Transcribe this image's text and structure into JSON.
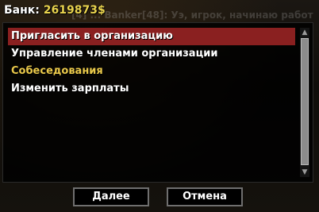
{
  "bank": {
    "label": "Банк:",
    "amount": "2619873$",
    "amount_color": "#e9d34e"
  },
  "background_text": "[4] ... Banker[48]: Уэ, игрок, начинаю работ",
  "menu": {
    "items": [
      {
        "label": "Пригласить в организацию",
        "selected": true,
        "color": "#ffffff"
      },
      {
        "label": "Управление членами организации",
        "selected": false,
        "color": "#ffffff"
      },
      {
        "label": "Собеседования",
        "selected": false,
        "color": "#e9c84a"
      },
      {
        "label": "Изменить зарплаты",
        "selected": false,
        "color": "#ffffff"
      }
    ],
    "selected_color": "#8a2020"
  },
  "scrollbar": {
    "up_icon": "triangle-up",
    "down_icon": "triangle-down"
  },
  "buttons": {
    "next_label": "Далее",
    "cancel_label": "Отмена"
  }
}
